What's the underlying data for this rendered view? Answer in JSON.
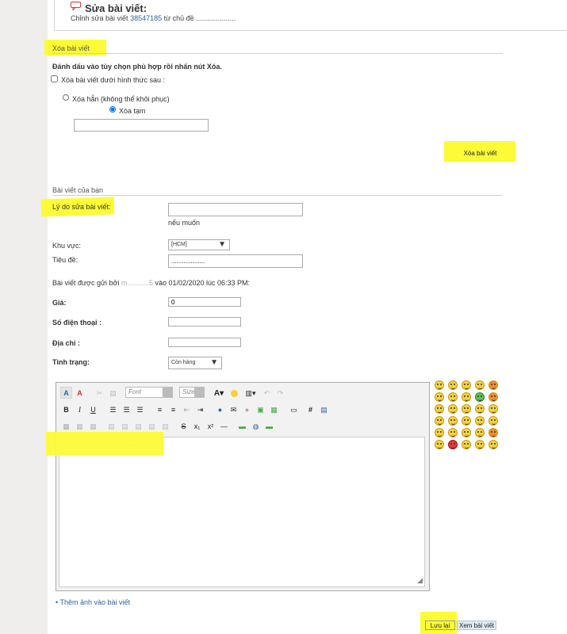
{
  "header": {
    "title": "Sửa bài viết:",
    "subtitle_prefix": "Chỉnh sửa bài viết",
    "post_id": "38547185",
    "subtitle_suffix": "từ chủ đề ...................."
  },
  "delete_section": {
    "title": "Xóa bài viết",
    "instruction": "Đánh dấu vào tùy chọn phù hợp rồi nhấn nút Xóa.",
    "checkbox_label": "Xóa bài viết dưới hình thức sau :",
    "radio_hard": "Xóa hẳn (không thể khôi phục)",
    "radio_soft": "Xóa tạm",
    "reason_value": "",
    "delete_button": "Xóa bài viết"
  },
  "post_section": {
    "title": "Bài viết của bạn",
    "reason_label": "Lý do sửa bài viết:",
    "reason_value": "",
    "reason_hint": "nếu muốn",
    "region_label": "Khu vực:",
    "region_value": "[HCM]",
    "title_label": "Tiêu đề:",
    "title_value": "...................",
    "posted_by_prefix": "Bài viết được gửi bởi",
    "posted_by_user": "m...........5",
    "posted_by_suffix": "vào 01/02/2020 lúc 06:33 PM:",
    "price_label": "Giá:",
    "price_value": "0",
    "phone_label": "Số điện thoại :",
    "phone_value": "",
    "address_label": "Địa chỉ :",
    "address_value": "",
    "status_label": "Tình trạng:",
    "status_value": "Còn hàng"
  },
  "editor": {
    "font_placeholder": "Font",
    "size_placeholder": "Size",
    "content": "....................................."
  },
  "footer": {
    "add_image_link": "Thêm ảnh vào bài viết",
    "save_button": "Lưu lại",
    "preview_button": "Xem bài viết"
  },
  "colors": {
    "highlight": "#fdfb37",
    "link": "#2e63a3",
    "page_bg": "#efeeec"
  }
}
